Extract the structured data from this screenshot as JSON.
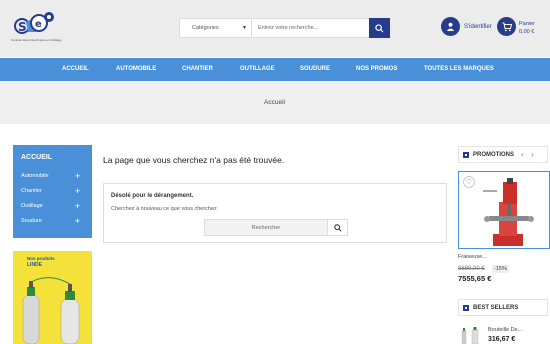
{
  "header": {
    "logo_caption": "Centrale Electrotechnique et Outillage",
    "search": {
      "category_label": "Catégories",
      "placeholder": "Entrez votre recherche..."
    },
    "login_label": "S'identifier",
    "cart": {
      "label": "Panier",
      "total": "0,00 €"
    }
  },
  "nav": {
    "items": [
      "ACCUEIL",
      "AUTOMOBILE",
      "CHANTIER",
      "OUTILLAGE",
      "SOUDURE",
      "NOS PROMOS",
      "TOUTES LES MARQUES"
    ]
  },
  "breadcrumb": {
    "current": "Accueil"
  },
  "sidebar": {
    "title": "ACCUEIL",
    "items": [
      {
        "label": "Automobile"
      },
      {
        "label": "Chantier"
      },
      {
        "label": "Outillage"
      },
      {
        "label": "Soudure"
      }
    ],
    "banner_text": [
      "Nos produits",
      "LINDE"
    ]
  },
  "main": {
    "heading": "La page que vous cherchez n'a pas été trouvée.",
    "sorry_title": "Désolé pour le dérangement.",
    "sorry_text": "Cherchez à nouveau ce que vous cherchez",
    "search_placeholder": "Rechercher"
  },
  "promotions": {
    "title": "PROMOTIONS",
    "product": {
      "name": "Fraiseuse...",
      "old_price": "8889,00 €",
      "discount": "-15%",
      "price": "7555,65 €"
    }
  },
  "best_sellers": {
    "title": "BEST SELLERS",
    "product": {
      "name": "Bouteille De...",
      "price": "316,67 €"
    }
  },
  "colors": {
    "brand_blue": "#273c8a",
    "nav_blue": "#4a90d9",
    "header_bg": "#ececec"
  }
}
